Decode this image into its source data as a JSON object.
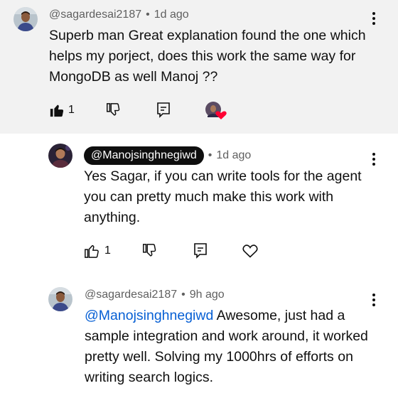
{
  "comments": [
    {
      "author": "@sagardesai2187",
      "time": "1d ago",
      "text": "Superb man Great explanation found the one which helps my porject, does this work the same way for MongoDB as well Manoj ??",
      "likes": "1"
    },
    {
      "author": "@Manojsinghnegiwd",
      "time": "1d ago",
      "text": "Yes Sagar, if you can write tools for the agent you can pretty much make this work with anything.",
      "likes": "1"
    },
    {
      "author": "@sagardesai2187",
      "time": "9h ago",
      "mention": "@Manojsinghnegiwd",
      "text": " Awesome, just had a sample integration and work around, it worked pretty well. Solving my 1000hrs of efforts on writing search logics."
    }
  ],
  "separator": "•",
  "icons": {
    "like_filled": "thumbs-up-filled-icon",
    "like": "thumbs-up-outline-icon",
    "dislike": "thumbs-down-icon",
    "reply": "reply-icon",
    "heart": "heart-icon",
    "more": "more-vertical-icon",
    "creator_heart": "creator-heart-badge"
  },
  "colors": {
    "mention": "#065fd4",
    "heart_badge": "#ff0033",
    "highlight_bg": "#f2f2f2"
  }
}
